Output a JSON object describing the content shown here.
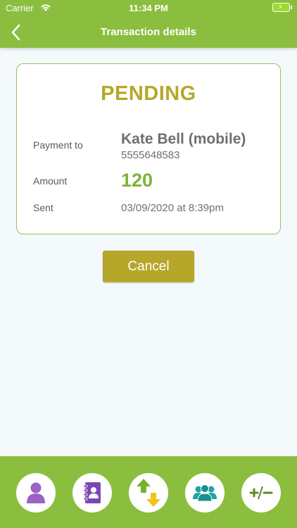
{
  "status_bar": {
    "carrier": "Carrier",
    "time": "11:34 PM"
  },
  "header": {
    "title": "Transaction details"
  },
  "transaction": {
    "status": "PENDING",
    "payment_to_label": "Payment to",
    "recipient_name": "Kate  Bell (mobile)",
    "recipient_phone": "5555648583",
    "amount_label": "Amount",
    "amount": "120",
    "sent_label": "Sent",
    "sent_value": "03/09/2020 at 8:39pm"
  },
  "actions": {
    "cancel_label": "Cancel"
  },
  "tab_bar": {
    "tabs": [
      {
        "icon": "person-icon"
      },
      {
        "icon": "contacts-book-icon"
      },
      {
        "icon": "transfer-arrows-icon"
      },
      {
        "icon": "group-icon"
      },
      {
        "icon": "plus-minus-icon"
      }
    ]
  },
  "colors": {
    "brand_green": "#8bbe3f",
    "status_gold": "#b6a72a",
    "amount_green": "#7fb33a"
  }
}
